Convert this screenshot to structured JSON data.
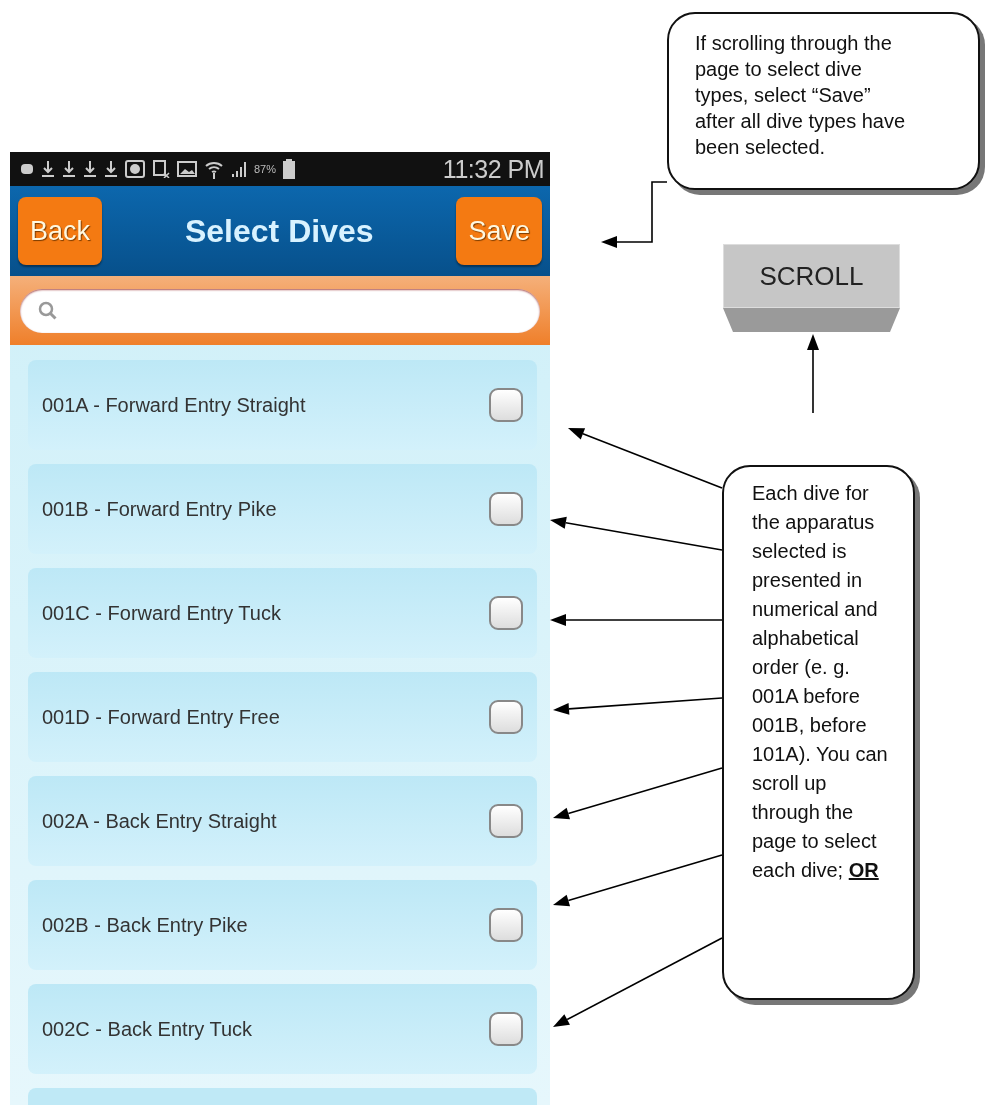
{
  "status_bar": {
    "battery": "87%",
    "time": "11:32 PM"
  },
  "header": {
    "back": "Back",
    "title": "Select Dives",
    "save": "Save"
  },
  "items": [
    {
      "label": "001A - Forward Entry Straight",
      "checked": false
    },
    {
      "label": "001B - Forward Entry Pike",
      "checked": false
    },
    {
      "label": "001C - Forward Entry Tuck",
      "checked": false
    },
    {
      "label": "001D - Forward Entry Free",
      "checked": false
    },
    {
      "label": "002A - Back Entry Straight",
      "checked": false
    },
    {
      "label": "002B - Back Entry Pike",
      "checked": false
    },
    {
      "label": "002C - Back Entry Tuck",
      "checked": false
    }
  ],
  "annotations": [
    {
      "kind": "callout",
      "text": "If scrolling through the page to select dive types, select “Save” after all dive types have been selected."
    },
    {
      "kind": "scroll_button",
      "text": "SCROLL"
    },
    {
      "kind": "callout",
      "text": "Each dive for the apparatus selected is presented in numerical and alphabetical order (e. g. 001A before 001B, before 101A).  You can scroll up through the page to select each dive; **OR**"
    }
  ]
}
